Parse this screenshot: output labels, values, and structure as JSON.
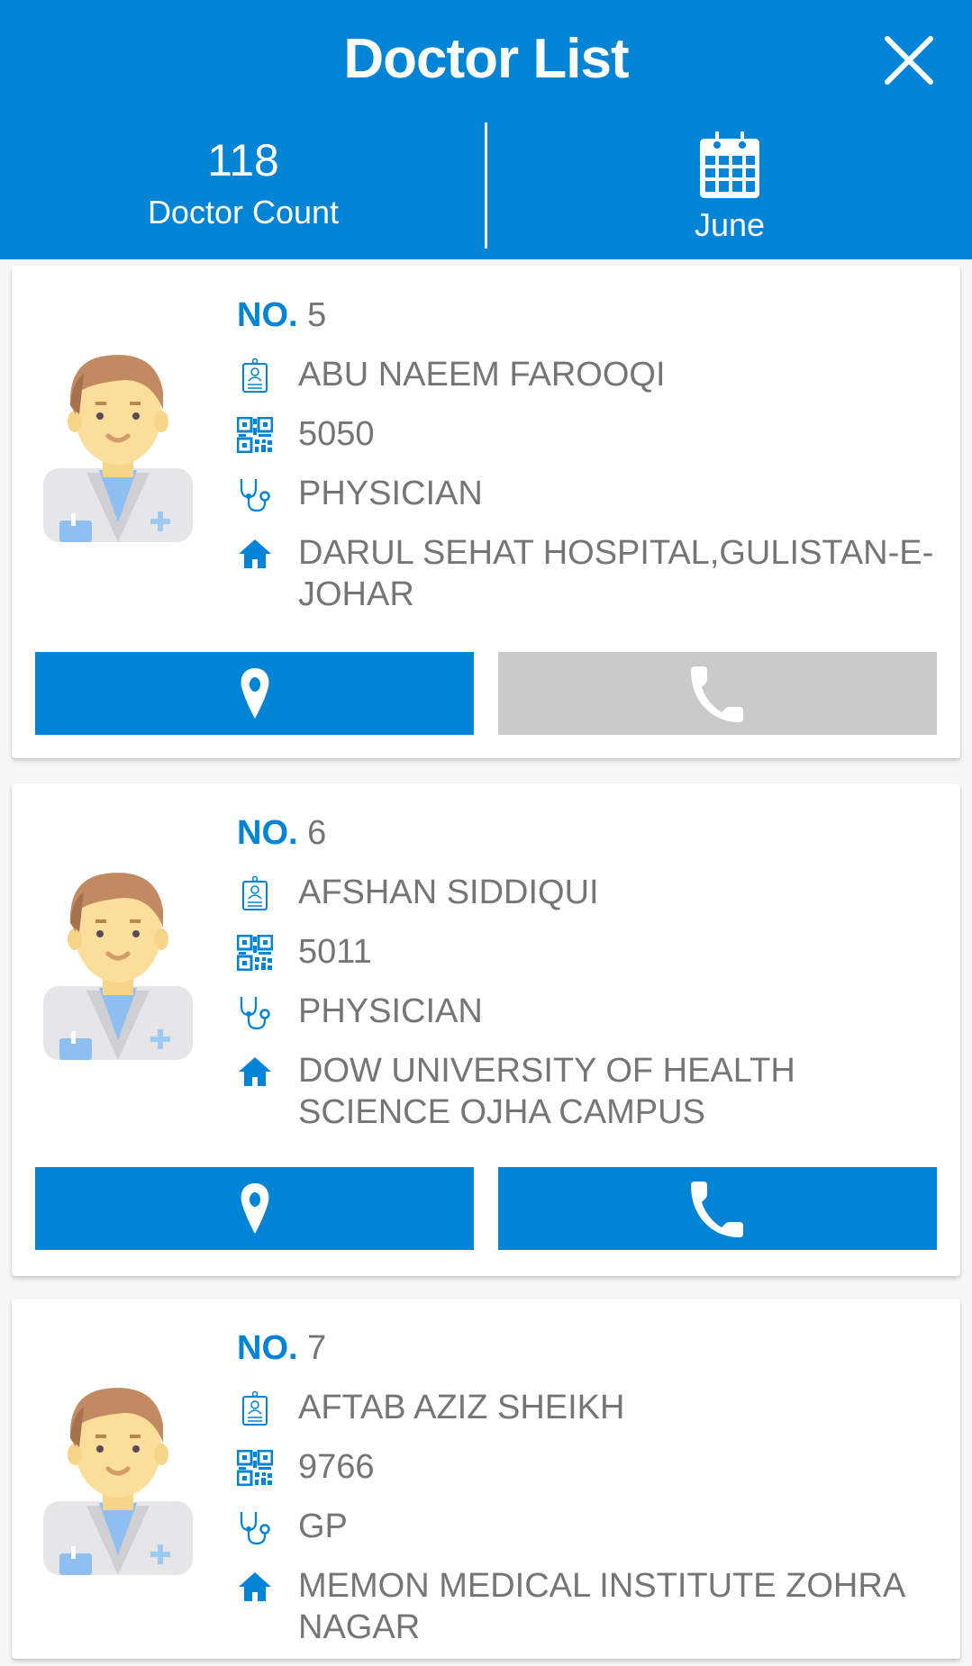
{
  "header": {
    "title": "Doctor List",
    "close_icon": "close-icon",
    "doctor_count": "118",
    "doctor_count_label": "Doctor Count",
    "calendar_icon": "calendar-icon",
    "month": "June"
  },
  "colors": {
    "primary": "#0184d6",
    "disabled": "#cacaca",
    "text": "#757575",
    "background": "#f7f7f7"
  },
  "labels": {
    "no": "NO."
  },
  "doctors": [
    {
      "no": "5",
      "name": "ABU NAEEM FAROOQI",
      "code": "5050",
      "specialty": "PHYSICIAN",
      "address": "DARUL SEHAT HOSPITAL,GULISTAN-E-JOHAR",
      "call_enabled": false
    },
    {
      "no": "6",
      "name": "AFSHAN SIDDIQUI",
      "code": "5011",
      "specialty": "PHYSICIAN",
      "address": "DOW UNIVERSITY OF HEALTH SCIENCE OJHA CAMPUS",
      "call_enabled": true
    },
    {
      "no": "7",
      "name": "AFTAB AZIZ SHEIKH",
      "code": "9766",
      "specialty": "GP",
      "address": "MEMON MEDICAL INSTITUTE ZOHRA NAGAR",
      "call_enabled": true
    }
  ]
}
